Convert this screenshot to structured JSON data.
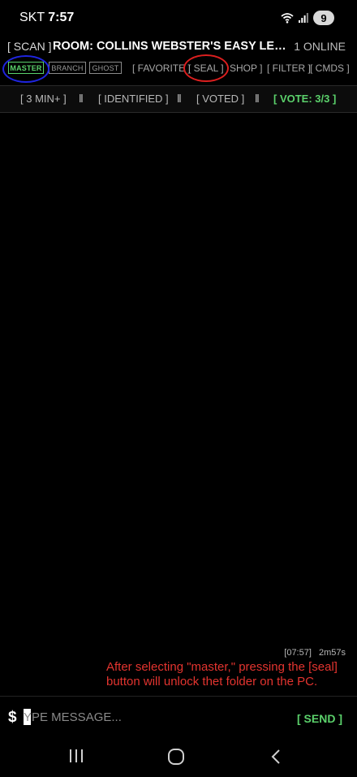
{
  "status_bar": {
    "carrier": "SKT",
    "time": "7:57",
    "battery": "9",
    "icons": [
      "wifi-icon",
      "signal-icon",
      "battery-icon"
    ]
  },
  "header": {
    "scan_label": "[ SCAN ]",
    "room_title": "ROOM: COLLINS WEBSTER'S EASY LEARN...",
    "online": "1 ONLINE"
  },
  "modes": {
    "master": "MASTER",
    "branch": "BRANCH",
    "ghost": "GHOST",
    "active": "MASTER"
  },
  "menu": {
    "favorite": "[ FAVORITE ]",
    "seal": "[ SEAL ]",
    "shop": "SHOP ]",
    "filter": "[ FILTER ]",
    "cmds": "[ CMDS ]"
  },
  "filters": {
    "three_min": "[ 3 MIN+ ]",
    "identified": "[ IDENTIFIED ]",
    "voted": "[ VOTED ]",
    "vote": "[ VOTE: 3/3 ]",
    "separator": "‖"
  },
  "message": {
    "time": "[07:57]",
    "age": "2m57s",
    "annotation": "After selecting \"master,\" pressing the [seal] button will  unlock thet folder on the PC."
  },
  "input": {
    "prompt": "$",
    "placeholder": "YPE MESSAGE...",
    "send": "[ SEND ]"
  },
  "colors": {
    "accent_green": "#5bd16b",
    "annotation_red": "#e3342f",
    "circle_blue": "#1f25e0",
    "circle_red": "#dc1f1f",
    "background": "#000000"
  },
  "nav": {
    "icons": [
      "recent-apps-icon",
      "home-icon",
      "back-icon"
    ]
  }
}
